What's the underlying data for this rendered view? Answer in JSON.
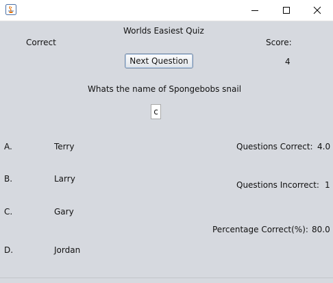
{
  "window": {
    "icon": "java-cup-icon",
    "controls": [
      "minimize-icon",
      "maximize-icon",
      "close-icon"
    ]
  },
  "quiz": {
    "title": "Worlds Easiest Quiz",
    "status_text": "Correct",
    "score_label": "Score:",
    "score_value": "4",
    "next_button_label": "Next Question",
    "question": "Whats the name of Spongebobs snail",
    "answer_input_value": "c",
    "options": [
      {
        "letter": "A.",
        "text": "Terry"
      },
      {
        "letter": "B.",
        "text": "Larry"
      },
      {
        "letter": "C.",
        "text": "Gary"
      },
      {
        "letter": "D.",
        "text": "Jordan"
      }
    ]
  },
  "stats": {
    "correct_label": "Questions Correct:",
    "correct_value": "4.0",
    "incorrect_label": "Questions Incorrect:",
    "incorrect_value": "1",
    "percentage_label": "Percentage Correct(%):",
    "percentage_value": "80.0"
  }
}
